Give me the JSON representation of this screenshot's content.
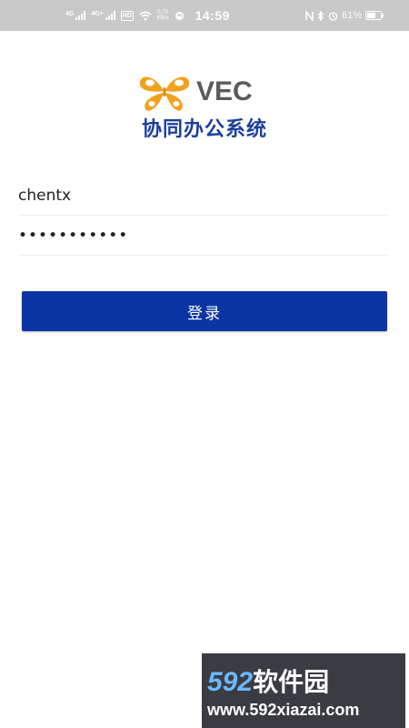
{
  "status_bar": {
    "network1": "4G",
    "network2": "4G+",
    "hd": "HD",
    "speed_value": "0.70",
    "speed_unit": "KB/s",
    "time": "14:59",
    "battery": "61%",
    "battery_level": 0.61
  },
  "app": {
    "logo_text": "VEC",
    "title": "协同办公系统",
    "logo_color": "#f2a11f",
    "title_color": "#1d3f9b"
  },
  "login": {
    "username_value": "chentx",
    "password_value": "sssssssssss",
    "button_label": "登录",
    "button_color": "#0c35a4"
  },
  "watermark": {
    "digits": "592",
    "cn": "软件园",
    "url": "www.592xiazai.com"
  }
}
